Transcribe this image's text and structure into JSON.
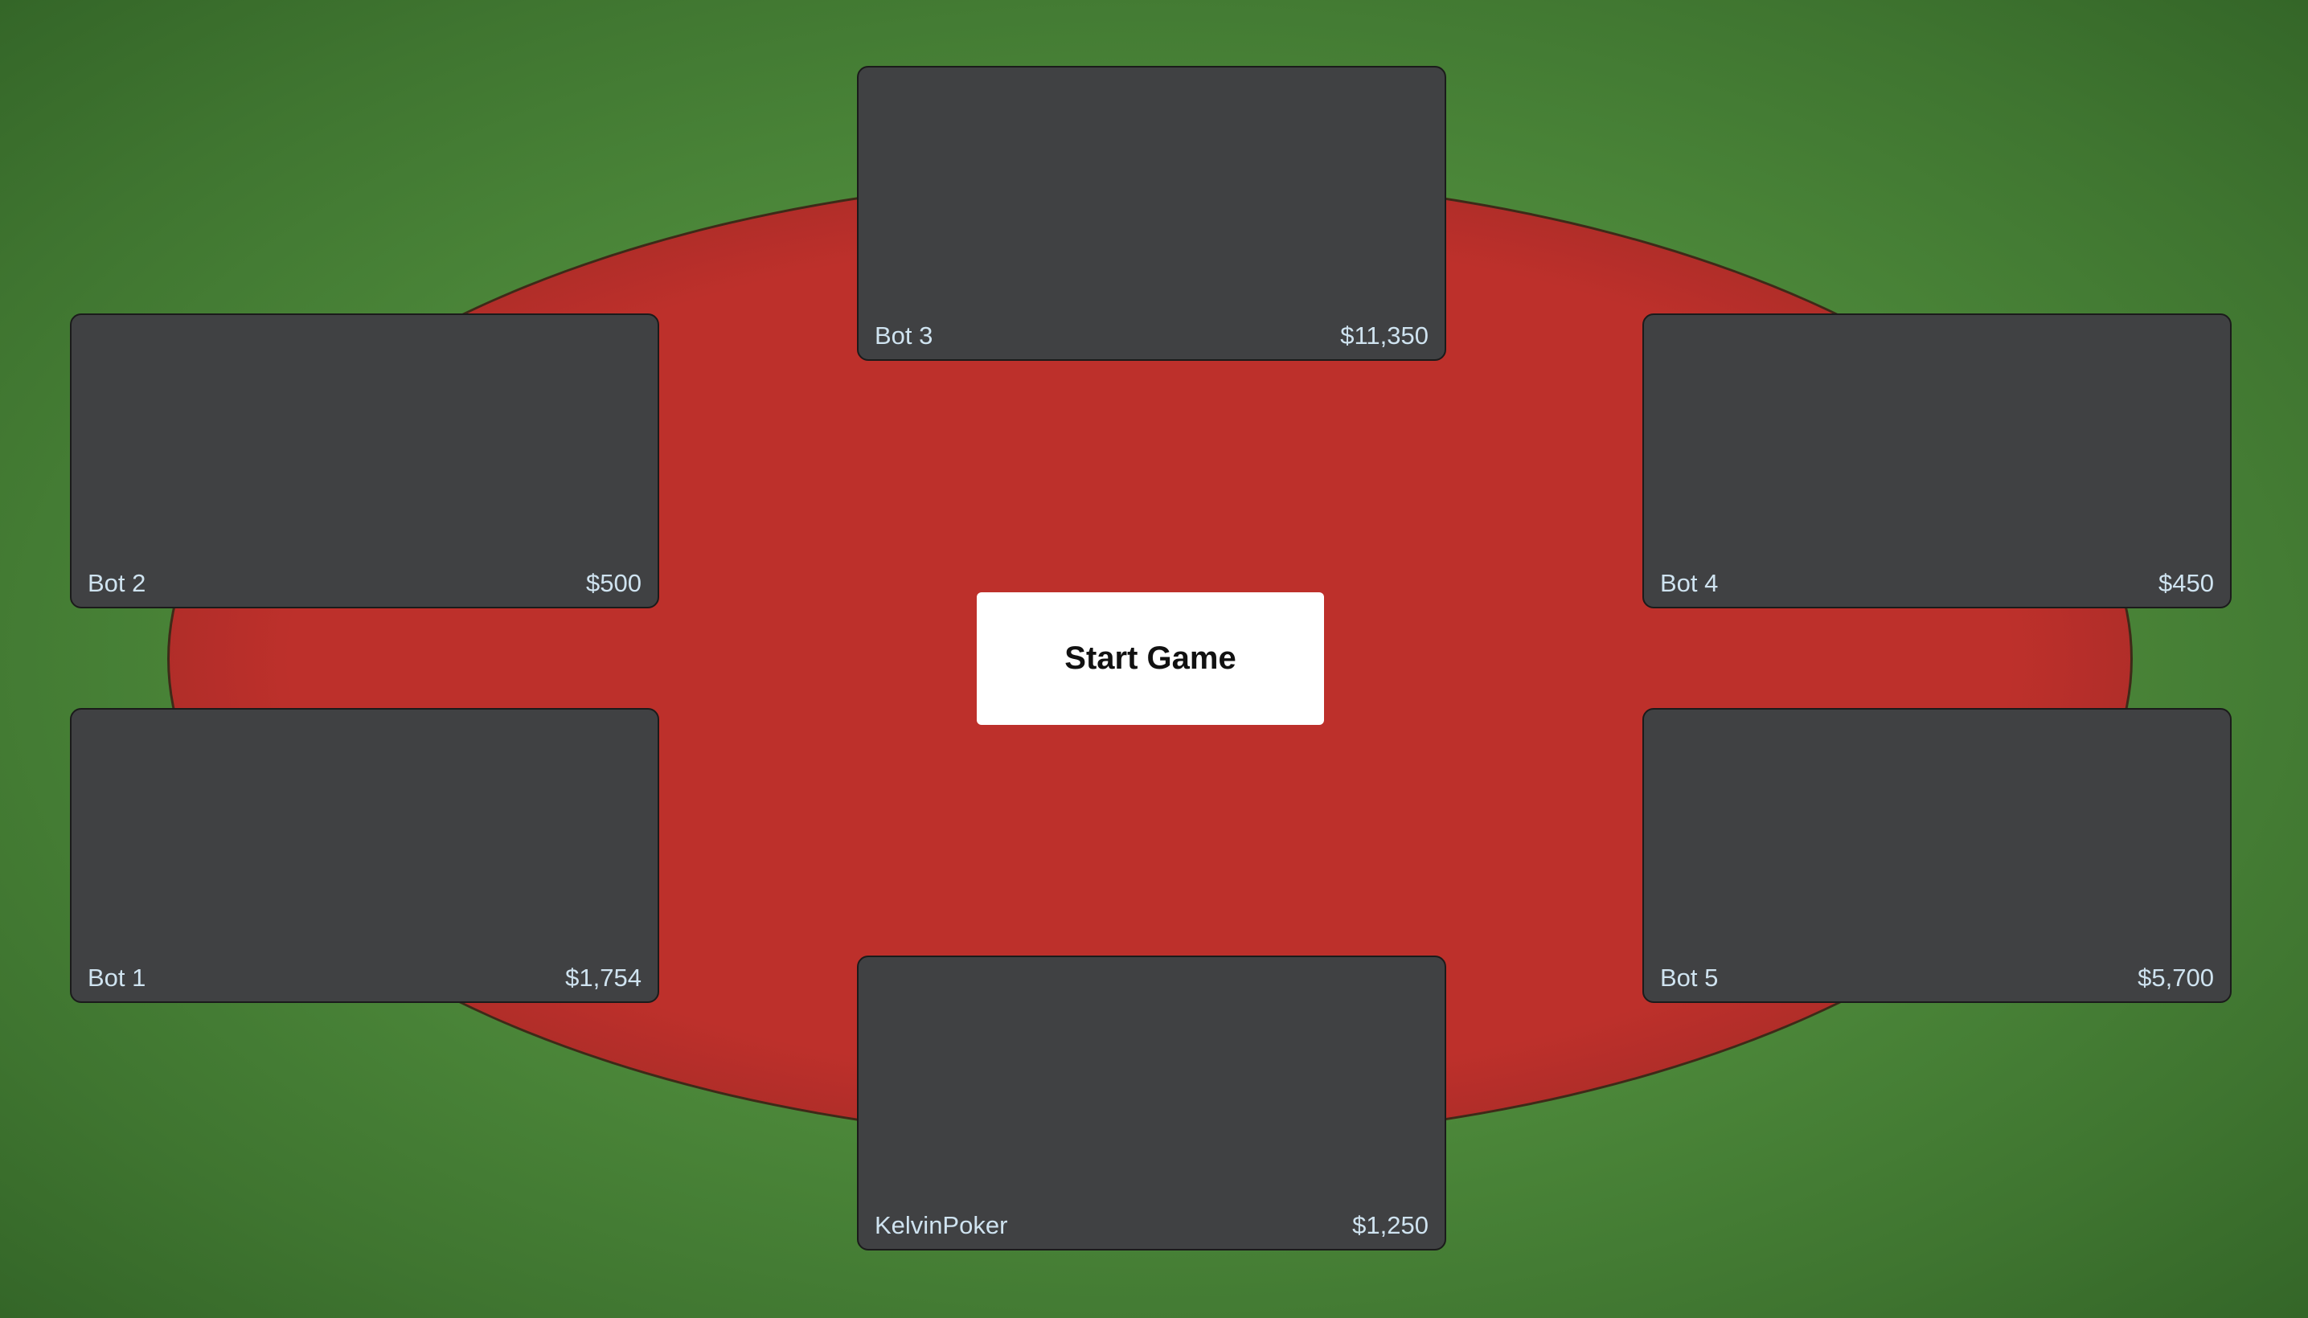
{
  "colors": {
    "background_green": "#4f8c3c",
    "table_red": "#bd302b",
    "seat_gray": "#404143",
    "seat_text": "#cfe3f0",
    "button_bg": "#ffffff"
  },
  "table": {
    "start_button_label": "Start Game"
  },
  "seats": {
    "top": {
      "name": "Bot 3",
      "stack": "$11,350"
    },
    "left_upper": {
      "name": "Bot 2",
      "stack": "$500"
    },
    "right_upper": {
      "name": "Bot 4",
      "stack": "$450"
    },
    "left_lower": {
      "name": "Bot 1",
      "stack": "$1,754"
    },
    "right_lower": {
      "name": "Bot 5",
      "stack": "$5,700"
    },
    "bottom": {
      "name": "KelvinPoker",
      "stack": "$1,250"
    }
  }
}
